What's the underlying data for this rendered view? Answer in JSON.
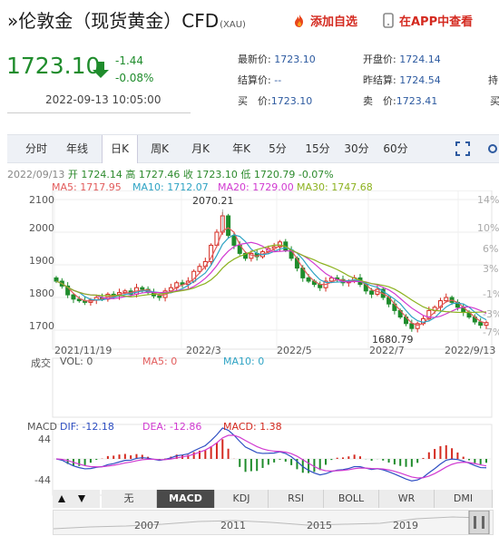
{
  "header": {
    "title_prefix": "»",
    "title": "伦敦金（现货黄金）CFD",
    "code": "(XAU)",
    "add_favorite": "添加自选",
    "app_view": "在APP中查看"
  },
  "quote": {
    "price": "1723.10",
    "change": "-1.44",
    "change_pct": "-0.08%",
    "timestamp": "2022-09-13 10:05:00",
    "latest_label": "最新价:",
    "latest_value": "1723.10",
    "open_label": "开盘价:",
    "open_value": "1724.14",
    "hold_label": "持",
    "settle_label": "结算价:",
    "settle_value": "--",
    "prev_settle_label": "昨结算:",
    "prev_settle_value": "1724.54",
    "buy_label": "买　价:",
    "buy_value": "1723.10",
    "sell_label": "卖　价:",
    "sell_value": "1723.41",
    "cut_label": "买"
  },
  "tabs": [
    "分时",
    "年线",
    "日K",
    "周K",
    "月K",
    "年K",
    "5分",
    "15分",
    "30分",
    "60分"
  ],
  "active_tab": "日K",
  "chart_info": {
    "date": "2022/09/13",
    "open": "开 1724.14",
    "high": "高 1727.46",
    "low": "低 1720.79",
    "close": "收 1723.10",
    "pct": "-0.07%",
    "ma5": "MA5: 1717.95",
    "ma10": "MA10: 1712.07",
    "ma20": "MA20: 1729.00",
    "ma30": "MA30: 1747.68",
    "max_label": "2070.21",
    "min_label": "1680.79",
    "volume": "成交",
    "vol": "VOL: 0",
    "vol_ma5": "MA5: 0",
    "vol_ma10": "MA10: 0",
    "macd_title": "MACD",
    "dif": "DIF: -12.18",
    "dea": "DEA: -12.86",
    "macd_val": "MACD: 1.38",
    "macd_top": "44",
    "macd_bottom": "-44"
  },
  "colors": {
    "up": "#d42a20",
    "down": "#1f8c2c",
    "ma5": "#e25b5b",
    "ma10": "#2ea3c4",
    "ma20": "#d13ad1",
    "ma30": "#8cb21f",
    "dif": "#2e4ec2",
    "dea": "#d13ad1"
  },
  "indicators": [
    "无",
    "MACD",
    "KDJ",
    "RSI",
    "BOLL",
    "WR",
    "DMI"
  ],
  "active_indicator": "MACD",
  "timeline_years": [
    "2007",
    "2011",
    "2015",
    "2019"
  ],
  "chart_data": {
    "type": "candlestick",
    "y_labels": [
      "2100",
      "2000",
      "1900",
      "1800",
      "1700"
    ],
    "y_pct_labels": [
      "14%",
      "10%",
      "6%",
      "3%",
      "-1%",
      "-3%",
      "-7%"
    ],
    "x_labels": [
      "2021/11/19",
      "2022/3",
      "2022/5",
      "2022/7",
      "2022/9/13"
    ],
    "ylim": [
      1650,
      2100
    ],
    "close_series": [
      1850,
      1835,
      1808,
      1795,
      1790,
      1785,
      1792,
      1800,
      1795,
      1810,
      1805,
      1815,
      1820,
      1810,
      1830,
      1825,
      1815,
      1805,
      1800,
      1820,
      1830,
      1845,
      1840,
      1850,
      1880,
      1895,
      1910,
      1960,
      2000,
      2050,
      1990,
      1960,
      1935,
      1920,
      1935,
      1925,
      1940,
      1950,
      1955,
      1970,
      1945,
      1920,
      1890,
      1860,
      1850,
      1840,
      1830,
      1850,
      1860,
      1855,
      1845,
      1850,
      1860,
      1840,
      1820,
      1810,
      1825,
      1800,
      1780,
      1760,
      1740,
      1720,
      1705,
      1720,
      1735,
      1760,
      1770,
      1790,
      1800,
      1785,
      1770,
      1755,
      1740,
      1725,
      1715,
      1723
    ]
  }
}
